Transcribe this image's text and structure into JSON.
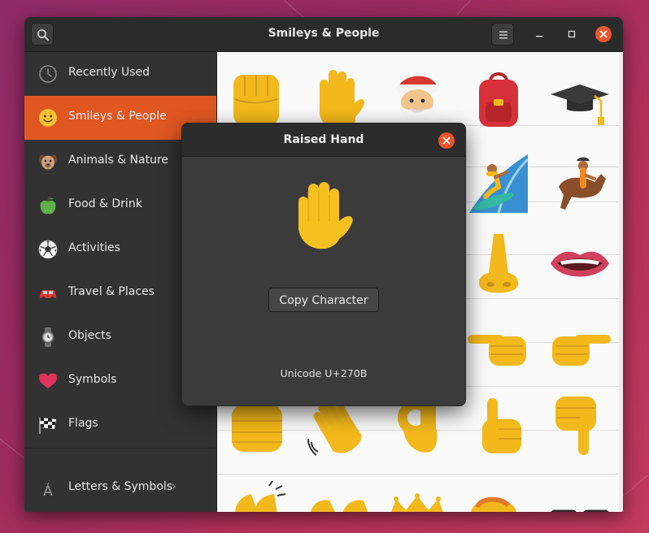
{
  "window": {
    "title": "Smileys & People",
    "icons": {
      "search": "search-icon",
      "menu": "hamburger-menu-icon",
      "minimize": "minimize-icon",
      "maximize": "maximize-icon",
      "close": "close-icon"
    }
  },
  "sidebar": {
    "items": [
      {
        "label": "Recently Used",
        "icon": "clock-icon"
      },
      {
        "label": "Smileys & People",
        "icon": "smiley-icon",
        "active": true
      },
      {
        "label": "Animals & Nature",
        "icon": "dog-icon"
      },
      {
        "label": "Food & Drink",
        "icon": "apple-icon"
      },
      {
        "label": "Activities",
        "icon": "soccer-ball-icon"
      },
      {
        "label": "Travel & Places",
        "icon": "car-icon"
      },
      {
        "label": "Objects",
        "icon": "watch-icon"
      },
      {
        "label": "Symbols",
        "icon": "heart-icon"
      },
      {
        "label": "Flags",
        "icon": "checkered-flag-icon"
      },
      {
        "label": "Letters & Symbols",
        "icon": "letter-a-acute-icon",
        "chevron": "›"
      }
    ]
  },
  "grid": {
    "emojis": [
      [
        "raised-fist",
        "raised-hand",
        "santa-claus",
        "backpack",
        "graduation-cap"
      ],
      [
        "",
        "",
        "",
        "person-surfing",
        "horse-racing"
      ],
      [
        "",
        "",
        "",
        "nose",
        "mouth"
      ],
      [
        "",
        "",
        "",
        "pointing-left",
        "pointing-right"
      ],
      [
        "oncoming-fist",
        "waving-hand",
        "ok-hand",
        "thumbs-up",
        "thumbs-down"
      ],
      [
        "clapping-hands",
        "open-hands",
        "crown",
        "womans-hat",
        "glasses"
      ]
    ]
  },
  "dialog": {
    "title": "Raised Hand",
    "emoji": "raised-hand",
    "copy_label": "Copy Character",
    "unicode": "Unicode U+270B"
  },
  "colors": {
    "accent": "#e05722",
    "close": "#e9552e",
    "emoji_yellow": "#f3b81b"
  }
}
